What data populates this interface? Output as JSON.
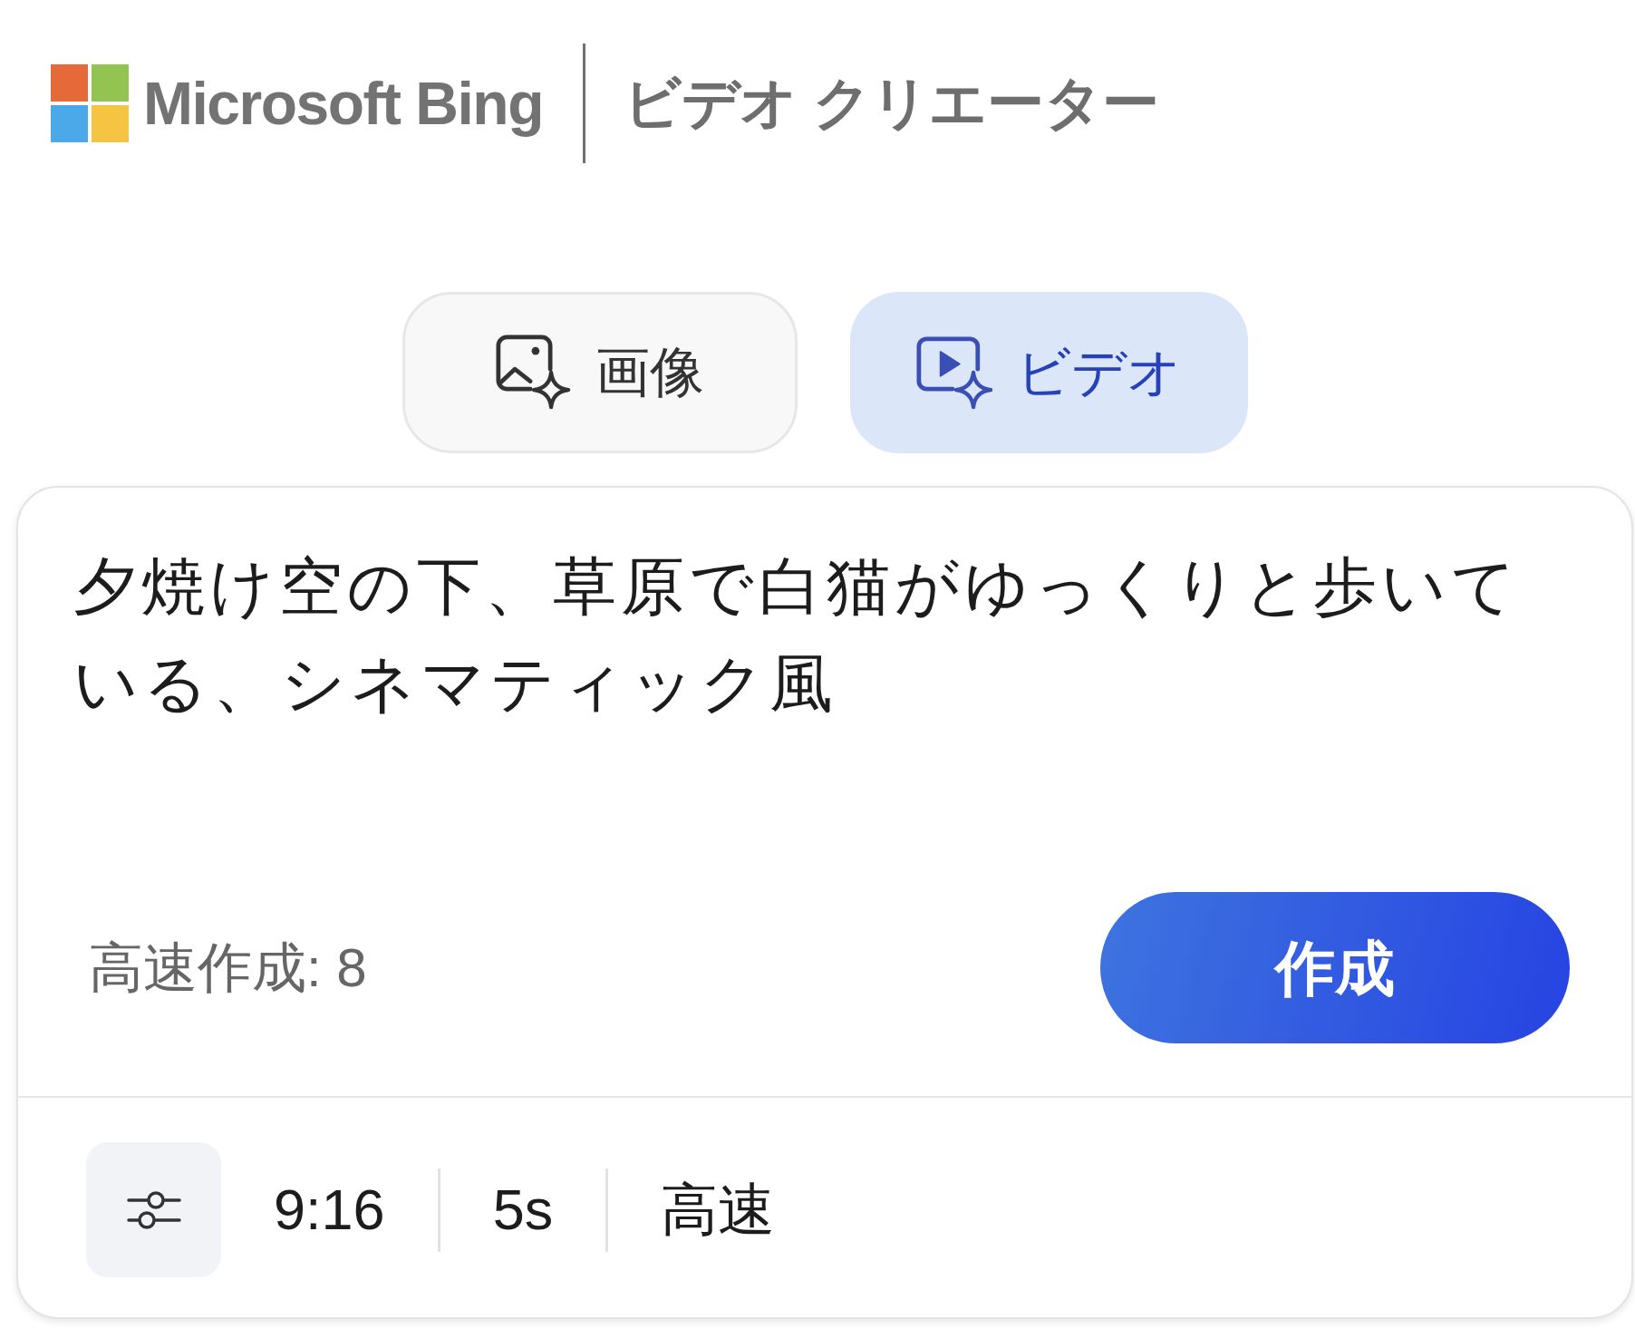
{
  "header": {
    "brand": "Microsoft Bing",
    "product": "ビデオ クリエーター"
  },
  "tabs": [
    {
      "label": "画像",
      "kind": "image",
      "selected": false
    },
    {
      "label": "ビデオ",
      "kind": "video",
      "selected": true
    }
  ],
  "prompt": {
    "value": "夕焼け空の下、草原で白猫がゆっくりと歩いている、シネマティック風"
  },
  "boost": {
    "label": "高速作成: 8"
  },
  "create_button": {
    "label": "作成"
  },
  "options": [
    "9:16",
    "5s",
    "高速"
  ]
}
